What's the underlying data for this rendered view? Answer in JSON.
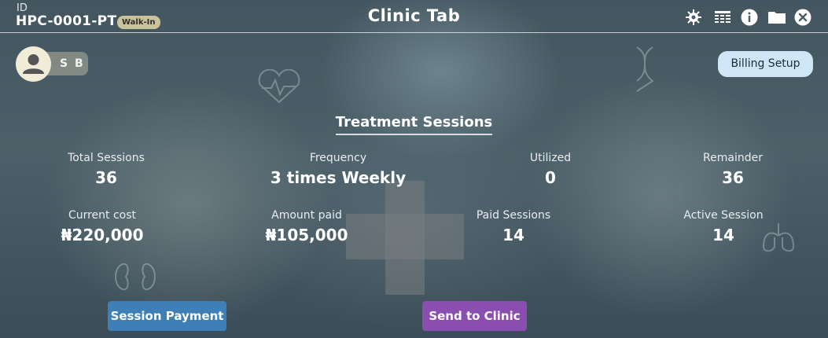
{
  "header": {
    "id_label": "ID",
    "patient_id": "HPC-0001-PT",
    "badge": "Walk-In",
    "title": "Clinic Tab",
    "icons": [
      "settings-icon",
      "table-icon",
      "info-icon",
      "folder-icon",
      "close-icon"
    ]
  },
  "profile": {
    "initials": "S B",
    "avatar_icon": "user-avatar-icon"
  },
  "billing_setup_label": "Billing Setup",
  "sessions": {
    "title": "Treatment Sessions",
    "total_sessions": {
      "label": "Total Sessions",
      "value": "36"
    },
    "frequency": {
      "label": "Frequency",
      "value": "3 times Weekly"
    },
    "utilized": {
      "label": "Utilized",
      "value": "0"
    },
    "remainder": {
      "label": "Remainder",
      "value": "36"
    },
    "current_cost": {
      "label": "Current cost",
      "value": "₦220,000"
    },
    "amount_paid": {
      "label": "Amount paid",
      "value": "₦105,000"
    },
    "paid_sessions": {
      "label": "Paid Sessions",
      "value": "14"
    },
    "active_session": {
      "label": "Active Session",
      "value": "14"
    }
  },
  "actions": {
    "session_payment": "Session Payment",
    "send_to_clinic": "Send to Clinic"
  },
  "colors": {
    "badge": "#c9c29a",
    "billing_button": "#cfe6f6",
    "session_payment_button": "#3d7fb6",
    "send_to_clinic_button": "#8a4db0"
  }
}
